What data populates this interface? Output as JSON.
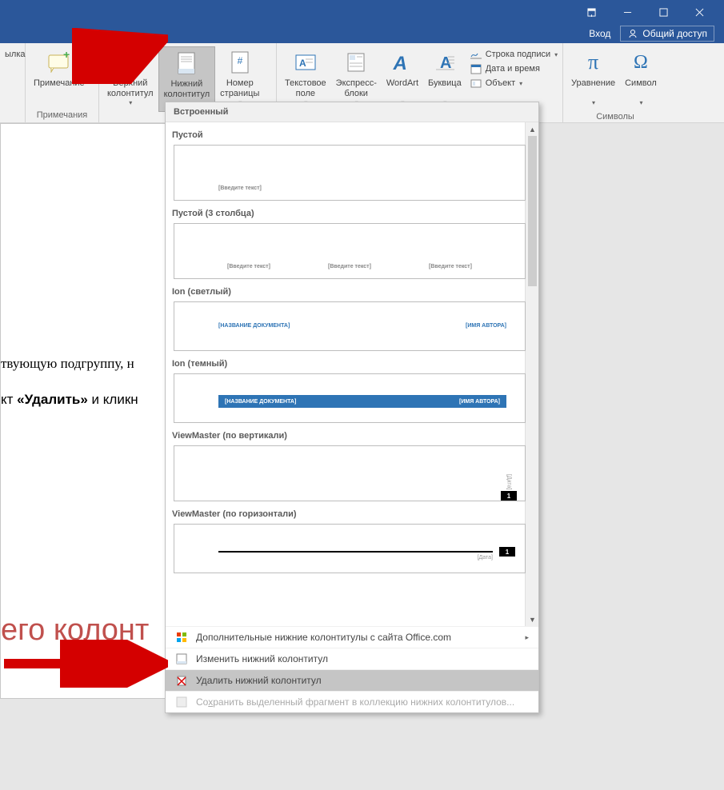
{
  "titlebar": {
    "login": "Вход",
    "share": "Общий доступ"
  },
  "ribbon": {
    "link": "ылка",
    "comment_group": "Примечания",
    "comment": "Примечание",
    "header": "Верхний\nколонтитул",
    "footer": "Нижний\nколонтитул",
    "pagenum": "Номер\nстраницы",
    "textbox": "Текстовое\nполе",
    "quickparts": "Экспресс-\nблоки",
    "wordart": "WordArt",
    "dropcap": "Буквица",
    "sigline": "Строка подписи",
    "datetime": "Дата и время",
    "object": "Объект",
    "equation": "Уравнение",
    "symbol": "Символ",
    "symbols_group": "Символы"
  },
  "dropdown": {
    "builtin": "Встроенный",
    "items": [
      {
        "title": "Пустой",
        "placeholder": "[Введите текст]"
      },
      {
        "title": "Пустой (3 столбца)",
        "placeholder": "[Введите текст]"
      },
      {
        "title": "Ion (светлый)",
        "doc": "[НАЗВАНИЕ ДОКУМЕНТА]",
        "author": "[ИМЯ АВТОРА]"
      },
      {
        "title": "Ion (темный)",
        "doc": "[НАЗВАНИЕ ДОКУМЕНТА]",
        "author": "[ИМЯ АВТОРА]"
      },
      {
        "title": "ViewMaster (по вертикали)",
        "date": "[Дата]",
        "page": "1"
      },
      {
        "title": "ViewMaster (по горизонтали)",
        "date": "[Дата]",
        "page": "1"
      }
    ],
    "more": "Дополнительные нижние колонтитулы с сайта Office.com",
    "edit": "Изменить нижний колонтитул",
    "remove": "Удалить нижний колонтитул",
    "save": "Сохранить выделенный фрагмент в коллекцию нижних колонтитулов..."
  },
  "doc": {
    "line1": "твующую подгруппу, н",
    "line2_a": "кт ",
    "line2_b": "«Удалить»",
    "line2_c": " и кликн",
    "heading": "его колонт"
  }
}
